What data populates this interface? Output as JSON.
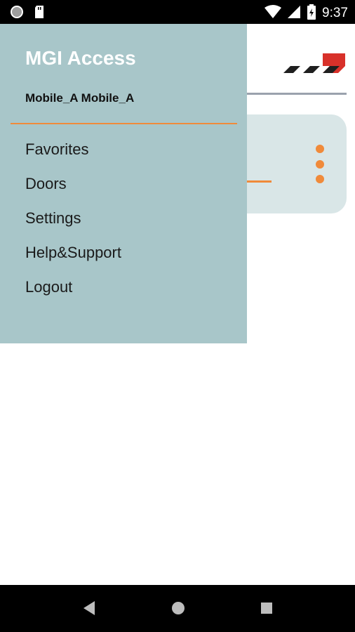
{
  "status_bar": {
    "time": "9:37",
    "icons": [
      "circle-status-icon",
      "sd-card-icon",
      "wifi-icon",
      "cell-signal-icon",
      "battery-icon"
    ]
  },
  "drawer": {
    "title": "MGI Access",
    "user_name": "Mobile_A Mobile_A",
    "items": [
      {
        "label": "Favorites"
      },
      {
        "label": "Doors"
      },
      {
        "label": "Settings"
      },
      {
        "label": "Help&Support"
      },
      {
        "label": "Logout"
      }
    ]
  },
  "colors": {
    "drawer_background": "#a8c6c9",
    "accent": "#f08a3a",
    "card_background": "#d9e6e7",
    "logo_red": "#d8312a"
  },
  "nav_bar": {
    "icons": [
      "back-icon",
      "home-icon",
      "recents-icon"
    ]
  }
}
